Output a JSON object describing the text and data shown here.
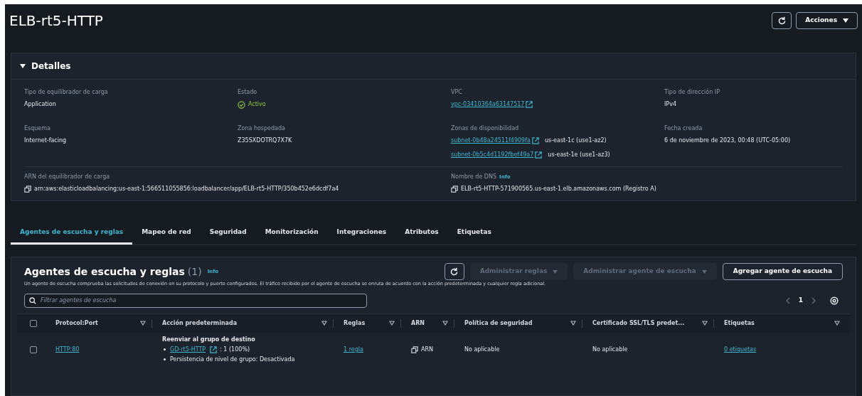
{
  "header": {
    "title": "ELB-rt5-HTTP",
    "actions_label": "Acciones"
  },
  "details": {
    "title": "Detalles",
    "expanded": true,
    "columns": [
      {
        "fields": [
          {
            "label": "Tipo de equilibrador de carga",
            "kind": "text",
            "value": "Application"
          },
          {
            "label": "Esquema",
            "kind": "text",
            "value": "Internet-facing"
          }
        ]
      },
      {
        "fields": [
          {
            "label": "Estado",
            "kind": "status",
            "value": "Activo"
          },
          {
            "label": "Zona hospedada",
            "kind": "text",
            "value": "Z35SXDOTRQ7X7K"
          }
        ]
      },
      {
        "fields": [
          {
            "label": "VPC",
            "kind": "links",
            "links": [
              {
                "link": "vpc-03410364a63147517"
              }
            ]
          },
          {
            "label": "Zonas de disponibilidad",
            "kind": "links",
            "links": [
              {
                "link": "subnet-0b48a24511f4909fa",
                "note": "us-east-1c (use1-az2)"
              },
              {
                "link": "subnet-0b5c4d1192fbef49a7",
                "note": "us-east-1e (use1-az3)"
              }
            ]
          }
        ]
      },
      {
        "fields": [
          {
            "label": "Tipo de dirección IP",
            "kind": "text",
            "value": "IPv4"
          },
          {
            "label": "Fecha creada",
            "kind": "text",
            "value": "6 de noviembre de 2023, 00:48 (UTC-05:00)"
          }
        ]
      }
    ],
    "bottom": [
      {
        "label": "ARN del equilibrador de carga",
        "value": "arn:aws:elasticloadbalancing:us-east-1:566511055856:loadbalancer/app/ELB-rt5-HTTP/350b452e6dcdf7a4"
      },
      {
        "label": "Nombre de DNS",
        "info": "Info",
        "value": "ELB-rt5-HTTP-571900565.us-east-1.elb.amazonaws.com (Registro A)"
      }
    ]
  },
  "tabs": [
    {
      "label": "Agentes de escucha y reglas",
      "selected": true
    },
    {
      "label": "Mapeo de red",
      "selected": false
    },
    {
      "label": "Seguridad",
      "selected": false
    },
    {
      "label": "Monitorización",
      "selected": false
    },
    {
      "label": "Integraciones",
      "selected": false
    },
    {
      "label": "Atributos",
      "selected": false
    },
    {
      "label": "Etiquetas",
      "selected": false
    }
  ],
  "listeners": {
    "title": "Agentes de escucha y reglas",
    "count": "(1)",
    "info": "Info",
    "description": "Un agente de escucha comprueba las solicitudes de conexión en su protocolo y puerto configurados. El tráfico recibido por el agente de escucha se enruta de acuerdo con la acción predeterminada y cualquier regla adicional.",
    "buttons": [
      {
        "label": "Administrar reglas",
        "disabled": true,
        "dropdown": true
      },
      {
        "label": "Administrar agente de escucha",
        "disabled": true,
        "dropdown": true
      },
      {
        "label": "Agregar agente de escucha",
        "disabled": false,
        "dropdown": false
      }
    ],
    "search": {
      "placeholder": "Filtrar agentes de escucha"
    },
    "page": "1",
    "all_checked": false,
    "columns": [
      "Protocol:Port",
      "Acción predeterminada",
      "Reglas",
      "ARN",
      "Política de seguridad",
      "Certificado SSL/TLS predet...",
      "Etiquetas"
    ],
    "rows": [
      {
        "checked": false,
        "protocol": "HTTP:80",
        "action_title": "Reenviar al grupo de destino",
        "action_target": "GD-rt5-HTTP",
        "action_weight": ": 1 (100%)",
        "action_note": "Persistencia de nivel de grupo: Desactivada",
        "rules": "1 regla",
        "arn": "ARN",
        "policy": "No aplicable",
        "certificate": "No aplicable",
        "tags": "0 etiquetas"
      }
    ]
  }
}
